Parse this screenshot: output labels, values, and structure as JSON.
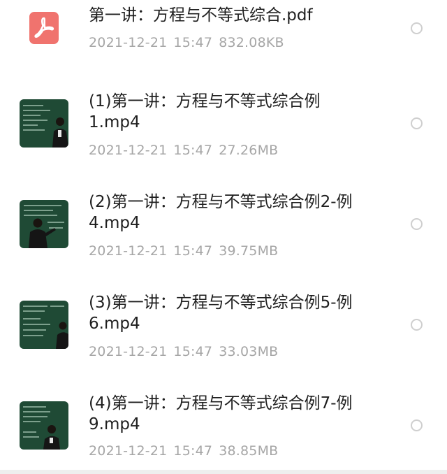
{
  "files": [
    {
      "name_line1": "第一讲：方程与不等式综合.pdf",
      "name_line2": "",
      "date": "2021-12-21",
      "time": "15:47",
      "size": "832.08KB",
      "icon": "pdf-icon"
    },
    {
      "name_line1": "(1)第一讲：方程与不等式综合例",
      "name_line2": "1.mp4",
      "date": "2021-12-21",
      "time": "15:47",
      "size": "27.26MB",
      "icon": "video-thumbnail"
    },
    {
      "name_line1": "(2)第一讲：方程与不等式综合例2-例",
      "name_line2": "4.mp4",
      "date": "2021-12-21",
      "time": "15:47",
      "size": "39.75MB",
      "icon": "video-thumbnail"
    },
    {
      "name_line1": "(3)第一讲：方程与不等式综合例5-例",
      "name_line2": "6.mp4",
      "date": "2021-12-21",
      "time": "15:47",
      "size": "33.03MB",
      "icon": "video-thumbnail"
    },
    {
      "name_line1": "(4)第一讲：方程与不等式综合例7-例",
      "name_line2": "9.mp4",
      "date": "2021-12-21",
      "time": "15:47",
      "size": "38.85MB",
      "icon": "video-thumbnail"
    }
  ],
  "colors": {
    "pdf_icon": "#f0736e",
    "title_text": "#1f1f1f",
    "meta_text": "#a6a6a6",
    "radio_border": "#cfcfcf",
    "blackboard": "#1f4a35"
  }
}
